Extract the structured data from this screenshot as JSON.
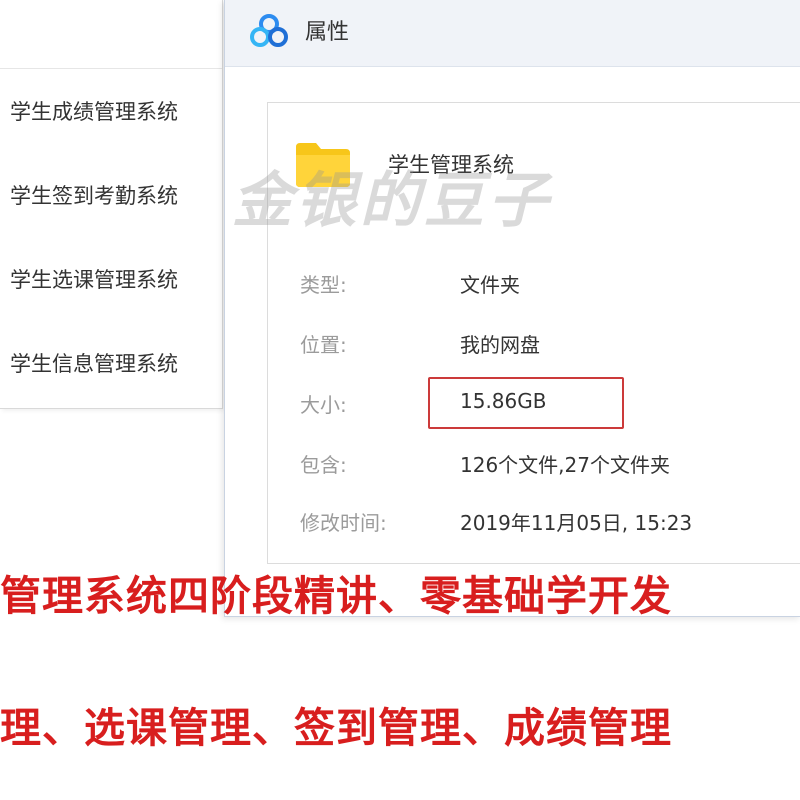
{
  "left_list": {
    "items": [
      {
        "label": "学生成绩管理系统"
      },
      {
        "label": "学生签到考勤系统"
      },
      {
        "label": "学生选课管理系统"
      },
      {
        "label": "学生信息管理系统"
      }
    ]
  },
  "dialog": {
    "title": "属性",
    "folder_name": "学生管理系统",
    "properties": [
      {
        "label": "类型:",
        "value": "文件夹"
      },
      {
        "label": "位置:",
        "value": "我的网盘"
      },
      {
        "label": "大小:",
        "value": "15.86GB"
      },
      {
        "label": "包含:",
        "value": "126个文件,27个文件夹"
      },
      {
        "label": "修改时间:",
        "value": "2019年11月05日, 15:23"
      }
    ]
  },
  "watermark": "金银的豆子",
  "promo": {
    "line1": "管理系统四阶段精讲、零基础学开发",
    "line2": "理、选课管理、签到管理、成绩管理"
  },
  "colors": {
    "accent_red": "#d81e1e",
    "highlight_border": "#cc3a3a",
    "folder_yellow": "#f7c61a",
    "cloud_blue": "#2d8cf0"
  }
}
